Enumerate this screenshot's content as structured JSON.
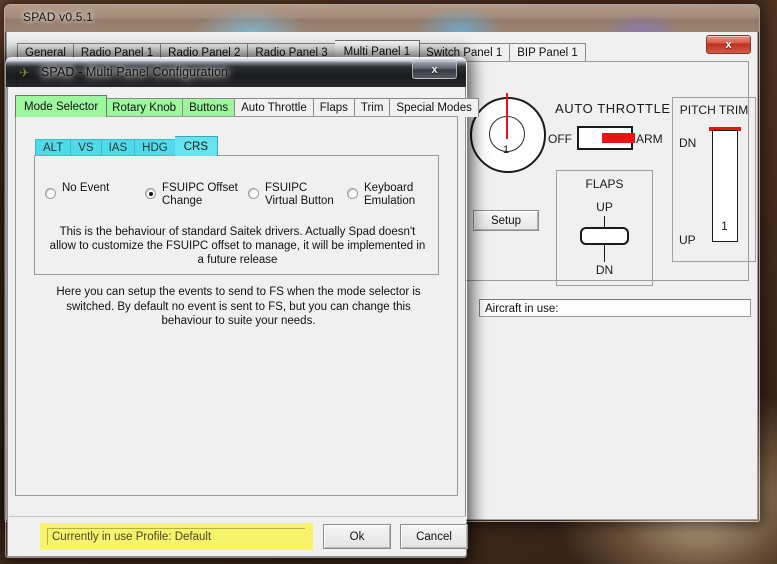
{
  "desktop": {
    "description": "blurred sepia brown wallpaper"
  },
  "main_window": {
    "title": "SPAD    v0.5.1",
    "close_label": "x",
    "tabs": [
      {
        "label": "General",
        "active": false
      },
      {
        "label": "Radio Panel 1",
        "active": false
      },
      {
        "label": "Radio Panel 2",
        "active": false
      },
      {
        "label": "Radio Panel 3",
        "active": false
      },
      {
        "label": "Multi Panel 1",
        "active": true
      },
      {
        "label": "Switch Panel 1",
        "active": false
      },
      {
        "label": "BIP Panel 1",
        "active": false
      }
    ],
    "panel": {
      "knob_value": "1",
      "setup_label": "Setup",
      "auto_throttle": {
        "title": "AUTO THROTTLE",
        "off_label": "OFF",
        "arm_label": "ARM",
        "position": "ARM"
      },
      "flaps": {
        "title": "FLAPS",
        "up_label": "UP",
        "dn_label": "DN"
      },
      "pitch_trim": {
        "title": "PITCH TRIM",
        "dn_label": "DN",
        "up_label": "UP",
        "value": "1"
      },
      "aircraft_in_use": "Aircraft in use:"
    }
  },
  "dialog": {
    "title": "SPAD - Multi Panel Configuration",
    "icon": "airplane-icon",
    "close_label": "x",
    "tabs": [
      {
        "label": "Mode Selector",
        "active": true,
        "highlighted": true
      },
      {
        "label": "Rotary Knob",
        "active": false,
        "highlighted": true
      },
      {
        "label": "Buttons",
        "active": false,
        "highlighted": true
      },
      {
        "label": "Auto Throttle",
        "active": false,
        "highlighted": false
      },
      {
        "label": "Flaps",
        "active": false,
        "highlighted": false
      },
      {
        "label": "Trim",
        "active": false,
        "highlighted": false
      },
      {
        "label": "Special Modes",
        "active": false,
        "highlighted": false
      }
    ],
    "sub_tabs": [
      {
        "label": "ALT",
        "active": false
      },
      {
        "label": "VS",
        "active": false
      },
      {
        "label": "IAS",
        "active": false
      },
      {
        "label": "HDG",
        "active": false
      },
      {
        "label": "CRS",
        "active": true
      }
    ],
    "radios": [
      {
        "label": "No Event",
        "selected": false
      },
      {
        "label": "FSUIPC Offset Change",
        "selected": true
      },
      {
        "label": "FSUIPC Virtual Button",
        "selected": false
      },
      {
        "label": "Keyboard Emulation",
        "selected": false
      }
    ],
    "sub_description": "This is the behaviour of standard Saitek drivers. Actually Spad doesn't allow to customize the FSUIPC offset to manage, it will be implemented in a future release",
    "help_text": "Here you can setup the events to send to FS when the mode selector is switched. By default no event is sent to FS, but you can change this behaviour to suite your needs.",
    "profile_text": "Currently in use Profile:   Default",
    "ok_label": "Ok",
    "cancel_label": "Cancel"
  },
  "colors": {
    "tab_highlight_green": "#9df79d",
    "subtab_cyan": "#4fdcea",
    "profile_yellow": "#f7f36b",
    "indicator_red": "#ee1111",
    "close_red": "#bc2f1e"
  }
}
